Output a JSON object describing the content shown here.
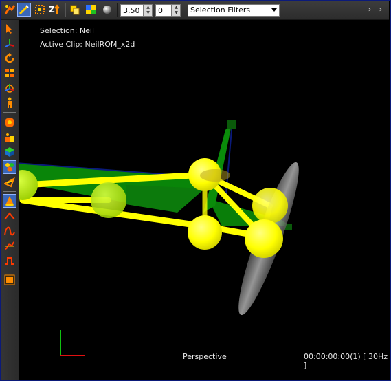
{
  "toolbar": {
    "scale_value": "3.50",
    "frame_value": "0",
    "filter_dropdown": "Selection Filters",
    "overflow": "› ›",
    "icons": [
      "camera-flash-icon",
      "select-tool-icon",
      "marquee-icon",
      "z-sort-icon",
      "copy-icon",
      "color-swatch-icon",
      "sphere-icon"
    ]
  },
  "left_tools": [
    "arrow-select-icon",
    "axis-move-icon",
    "rotate-icon",
    "scale-icon",
    "axes-icon",
    "character-icon",
    "lasso-icon",
    "actor-icon",
    "cube-icon",
    "palette-icon",
    "ribbon-icon",
    "cone-icon",
    "curve-up-icon",
    "curve-arc-icon",
    "curve-s-icon",
    "step-icon",
    "list-icon"
  ],
  "viewport": {
    "selection": "Selection: Neil",
    "active_clip": "Active Clip: NeilROM_x2d",
    "view_mode": "Perspective",
    "timecode": "00:00:00:00(1) [ 30Hz ]"
  },
  "colors": {
    "bone": "#ffff00",
    "segment": "#0a8c0a",
    "selection": "#3a67b8",
    "axis_x": "#e01010",
    "axis_y": "#10c010"
  }
}
